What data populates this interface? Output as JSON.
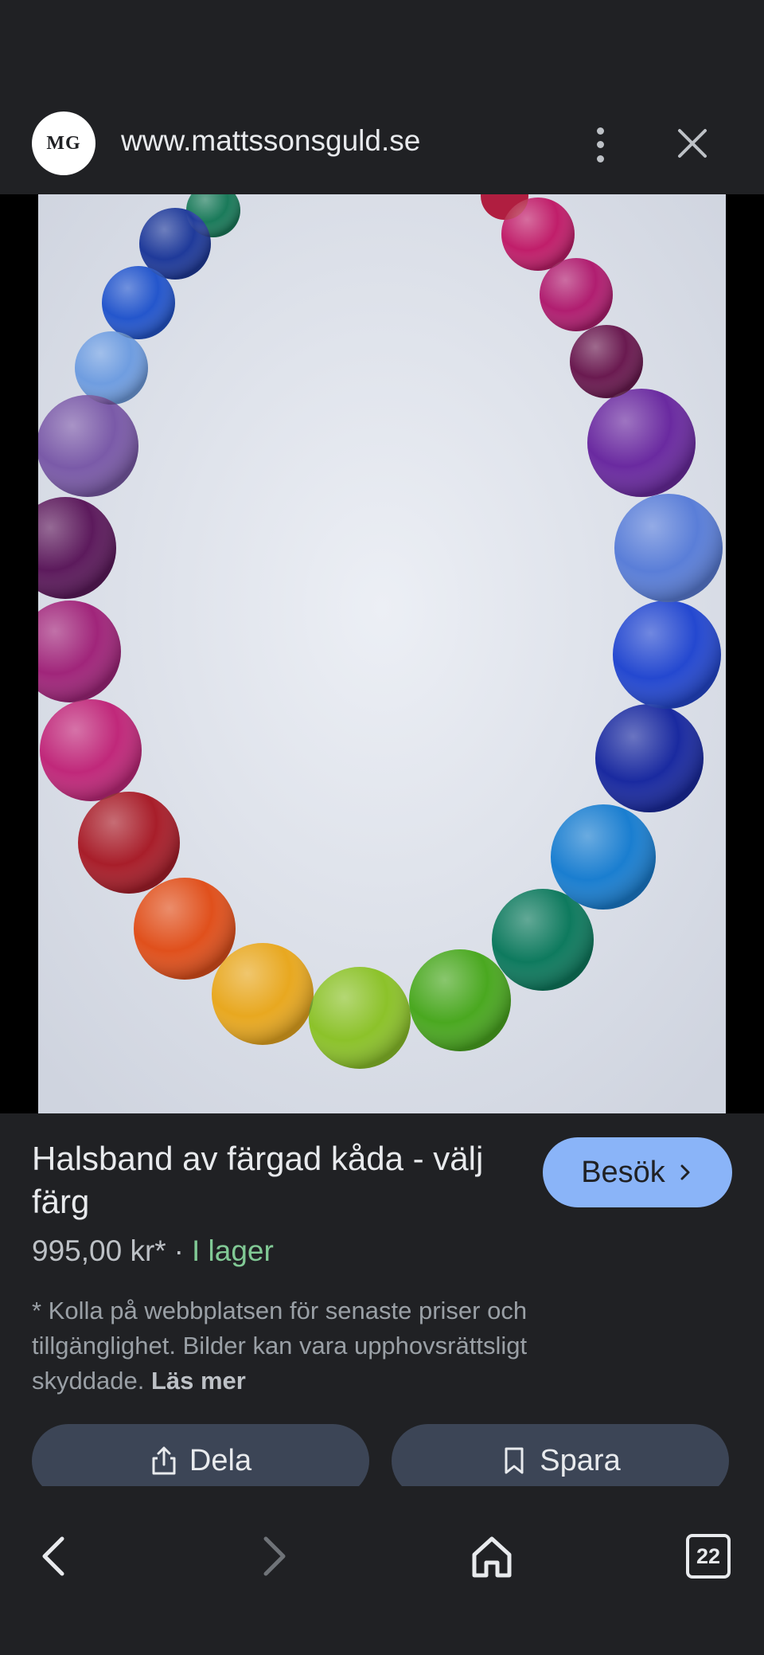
{
  "header": {
    "logo_text": "MG",
    "site_url": "www.mattssonsguld.se",
    "menu_icon": "more-vert-icon",
    "close_icon": "close-icon"
  },
  "image": {
    "description_icon": "necklace-image",
    "background_color": "#d9dde8"
  },
  "product": {
    "title": "Halsband av färgad kåda - välj färg",
    "visit_label": "Besök",
    "price": "995,00 kr*",
    "separator": "·",
    "stock": "I lager",
    "disclaimer": "* Kolla på webbplatsen för senaste priser och tillgänglighet. Bilder kan vara upphovsrättsligt skyddade.",
    "read_more": "Läs mer"
  },
  "actions": {
    "share_label": "Dela",
    "save_label": "Spara"
  },
  "nav": {
    "tab_count": "22"
  },
  "colors": {
    "background": "#202124",
    "accent": "#8ab4f8",
    "stock_green": "#81c995",
    "button_bg": "#3c4556"
  }
}
